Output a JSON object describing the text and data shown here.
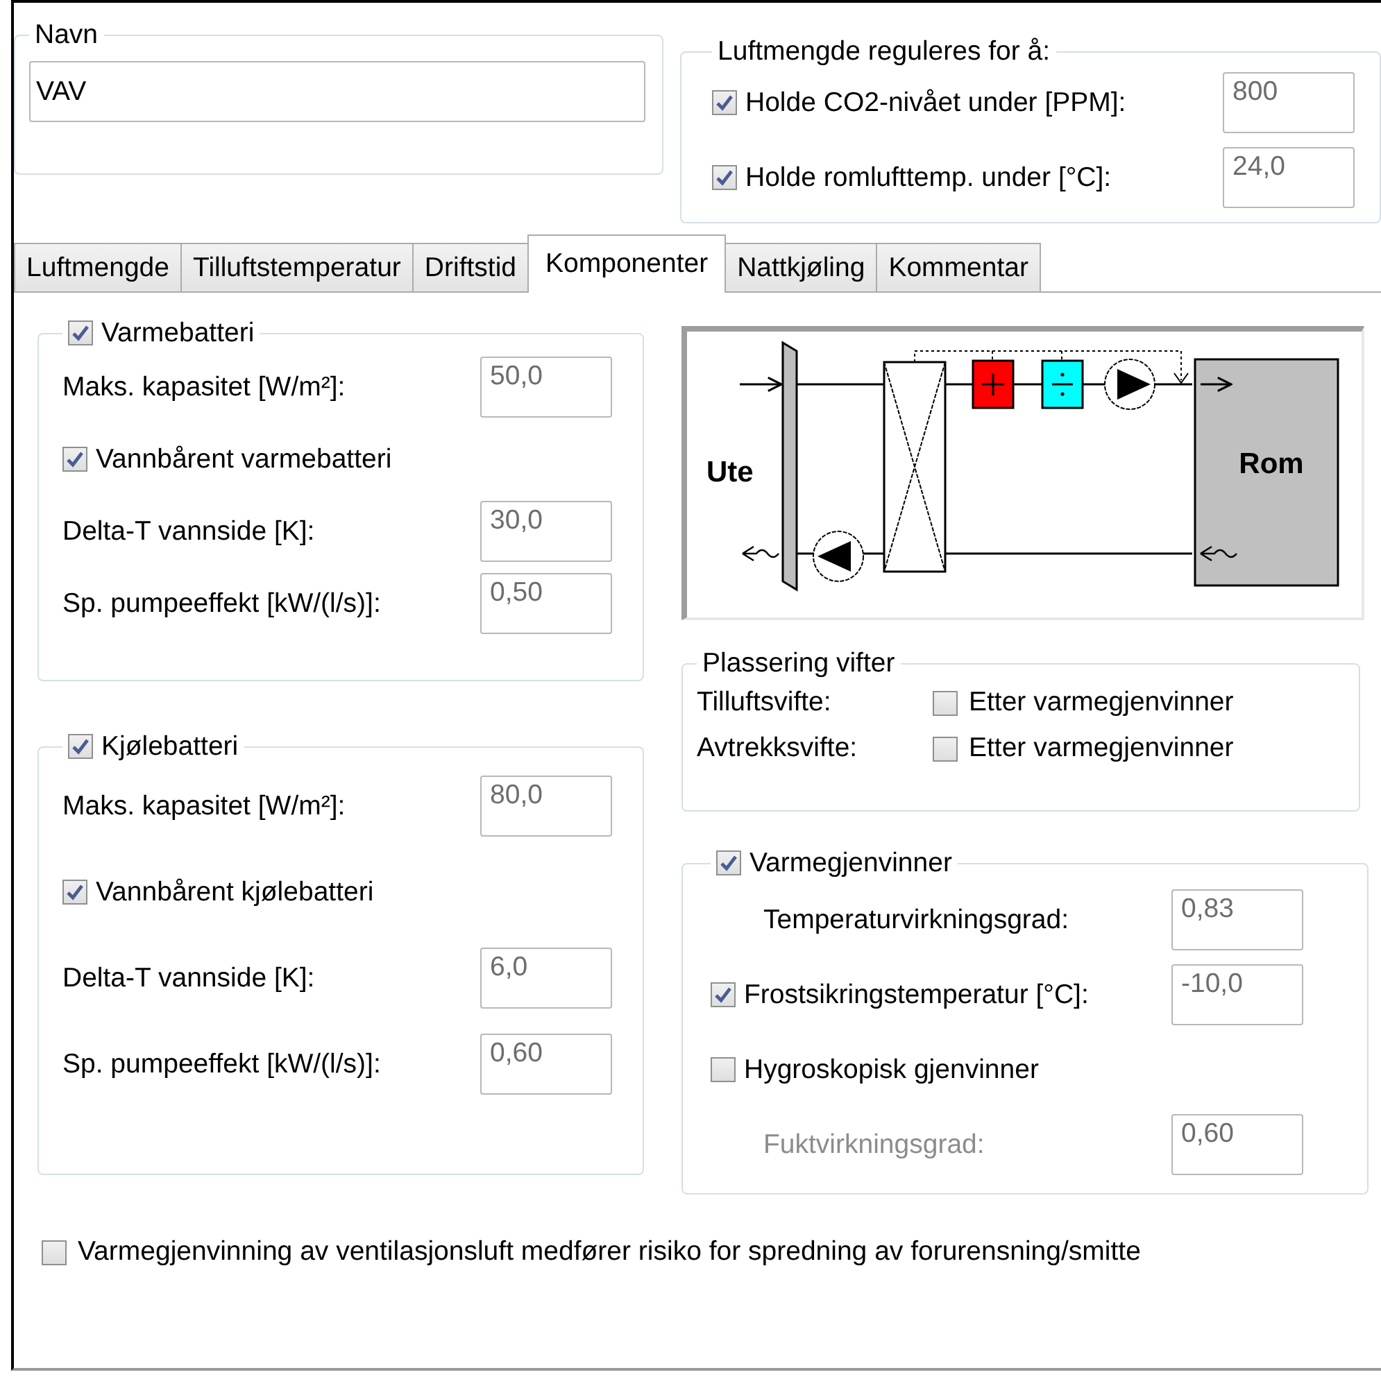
{
  "name_group": {
    "legend": "Navn",
    "value": "VAV"
  },
  "airflow_group": {
    "legend": "Luftmengde reguleres for å:",
    "options": [
      {
        "label": "Holde CO2-nivået under [PPM]:",
        "checked": true,
        "value": "800"
      },
      {
        "label": "Holde romlufttemp. under [°C]:",
        "checked": true,
        "value": "24,0"
      }
    ]
  },
  "tabs": [
    {
      "label": "Luftmengde",
      "selected": false
    },
    {
      "label": "Tilluftstemperatur",
      "selected": false
    },
    {
      "label": "Driftstid",
      "selected": false
    },
    {
      "label": "Komponenter",
      "selected": true
    },
    {
      "label": "Nattkjøling",
      "selected": false
    },
    {
      "label": "Kommentar",
      "selected": false
    }
  ],
  "heating_coil": {
    "label": "Varmebatteri",
    "checked": true,
    "rows": [
      {
        "kind": "field",
        "label": "Maks. kapasitet [W/m²]:",
        "value": "50,0"
      },
      {
        "kind": "checkbox",
        "label": "Vannbårent varmebatteri",
        "checked": true
      },
      {
        "kind": "field",
        "label": "Delta-T vannside  [K]:",
        "value": "30,0"
      },
      {
        "kind": "field",
        "label": "Sp. pumpeeffekt [kW/(l/s)]:",
        "value": "0,50"
      }
    ]
  },
  "cooling_coil": {
    "label": "Kjølebatteri",
    "checked": true,
    "rows": [
      {
        "kind": "field",
        "label": "Maks. kapasitet [W/m²]:",
        "value": "80,0"
      },
      {
        "kind": "checkbox",
        "label": "Vannbårent kjølebatteri",
        "checked": true
      },
      {
        "kind": "field",
        "label": "Delta-T vannside [K]:",
        "value": "6,0"
      },
      {
        "kind": "field",
        "label": "Sp. pumpeeffekt [kW/(l/s)]:",
        "value": "0,60"
      }
    ]
  },
  "diagram": {
    "outdoor_label": "Ute",
    "room_label": "Rom"
  },
  "fan_placement": {
    "legend": "Plassering vifter",
    "rows": [
      {
        "label": "Tilluftsvifte:",
        "option": "Etter varmegjenvinner",
        "checked": false
      },
      {
        "label": "Avtrekksvifte:",
        "option": "Etter varmegjenvinner",
        "checked": false
      }
    ]
  },
  "heat_recovery": {
    "label": "Varmegjenvinner",
    "checked": true,
    "rows": [
      {
        "kind": "field",
        "label": "Temperaturvirkningsgrad:",
        "value": "0,83",
        "disabled": false
      },
      {
        "kind": "checkfield",
        "label": "Frostsikringstemperatur [°C]:",
        "checked": true,
        "value": "-10,0"
      },
      {
        "kind": "checkbox",
        "label": "Hygroskopisk gjenvinner",
        "checked": false
      },
      {
        "kind": "field",
        "label": "Fuktvirkningsgrad:",
        "value": "0,60",
        "disabled": true
      }
    ]
  },
  "footer_option": {
    "label": "Varmegjenvinning av ventilasjonsluft medfører risiko for spredning av forurensning/smitte",
    "checked": false
  }
}
